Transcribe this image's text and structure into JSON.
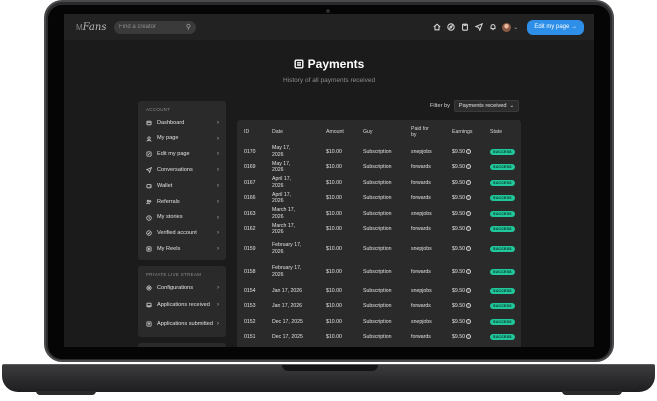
{
  "topbar": {
    "logo_prefix": "M",
    "logo_script": "Fans",
    "search_placeholder": "Find a creator",
    "edit_button": "Edit my page →"
  },
  "page": {
    "title": "Payments",
    "subtitle": "History of all payments received"
  },
  "sidebar": {
    "account_header": "ACCOUNT",
    "account_items": [
      {
        "label": "Dashboard",
        "icon": "dashboard-icon"
      },
      {
        "label": "My page",
        "icon": "page-icon"
      },
      {
        "label": "Edit my page",
        "icon": "edit-icon"
      },
      {
        "label": "Conversations",
        "icon": "send-icon"
      },
      {
        "label": "Wallet",
        "icon": "wallet-icon"
      },
      {
        "label": "Referrals",
        "icon": "users-icon"
      },
      {
        "label": "My stories",
        "icon": "stories-icon"
      },
      {
        "label": "Verified account",
        "icon": "verified-icon"
      },
      {
        "label": "My Reels",
        "icon": "reels-icon"
      }
    ],
    "live_header": "PRIVATE LIVE STREAM",
    "live_items": [
      {
        "label": "Configurations",
        "icon": "gear-icon"
      },
      {
        "label": "Applications received",
        "icon": "inbox-icon"
      },
      {
        "label": "Applications submitted",
        "icon": "submit-icon"
      }
    ]
  },
  "filter": {
    "label": "Filter by",
    "value": "Payments received"
  },
  "table": {
    "headers": [
      "ID",
      "Date",
      "Amount",
      "Guy",
      "Paid for by",
      "Earnings",
      "State"
    ],
    "rows": [
      {
        "id": "0170",
        "date": "May 17, 2026",
        "amount": "$10.00",
        "guy": "Subscription",
        "paid_by": "snepjobs",
        "earnings": "$9.50",
        "state": "SUCCESS"
      },
      {
        "id": "0169",
        "date": "May 17, 2026",
        "amount": "$10.00",
        "guy": "Subscription",
        "paid_by": "forwards",
        "earnings": "$9.50",
        "state": "SUCCESS"
      },
      {
        "id": "0167",
        "date": "April 17, 2026",
        "amount": "$10.00",
        "guy": "Subscription",
        "paid_by": "forwards",
        "earnings": "$9.50",
        "state": "SUCCESS"
      },
      {
        "id": "0166",
        "date": "April 17, 2026",
        "amount": "$10.00",
        "guy": "Subscription",
        "paid_by": "forwards",
        "earnings": "$9.50",
        "state": "SUCCESS"
      },
      {
        "id": "0163",
        "date": "March 17, 2026",
        "amount": "$10.00",
        "guy": "Subscription",
        "paid_by": "snepjobs",
        "earnings": "$9.50",
        "state": "SUCCESS"
      },
      {
        "id": "0162",
        "date": "March 17, 2026",
        "amount": "$10.00",
        "guy": "Subscription",
        "paid_by": "forwards",
        "earnings": "$9.50",
        "state": "SUCCESS"
      },
      {
        "id": "0159",
        "date": "February 17, 2026",
        "amount": "$10.00",
        "guy": "Subscription",
        "paid_by": "snepjobs",
        "earnings": "$9.50",
        "state": "SUCCESS"
      },
      {
        "id": "0158",
        "date": "February 17, 2026",
        "amount": "$10.00",
        "guy": "Subscription",
        "paid_by": "forwards",
        "earnings": "$9.50",
        "state": "SUCCESS"
      },
      {
        "id": "0154",
        "date": "Jan 17, 2026",
        "amount": "$10.00",
        "guy": "Subscription",
        "paid_by": "snepjobs",
        "earnings": "$9.50",
        "state": "SUCCESS"
      },
      {
        "id": "0153",
        "date": "Jan 17, 2026",
        "amount": "$10.00",
        "guy": "Subscription",
        "paid_by": "forwards",
        "earnings": "$9.50",
        "state": "SUCCESS"
      },
      {
        "id": "0152",
        "date": "Dec 17, 2025",
        "amount": "$10.00",
        "guy": "Subscription",
        "paid_by": "snepjobs",
        "earnings": "$9.50",
        "state": "SUCCESS"
      },
      {
        "id": "0151",
        "date": "Dec 17, 2025",
        "amount": "$10.00",
        "guy": "Subscription",
        "paid_by": "forwards",
        "earnings": "$9.50",
        "state": "SUCCESS"
      }
    ]
  },
  "colors": {
    "accent": "#2e8fe8",
    "success": "#1fc79a",
    "panel": "#2a2a2a",
    "background": "#1b1b1b"
  }
}
